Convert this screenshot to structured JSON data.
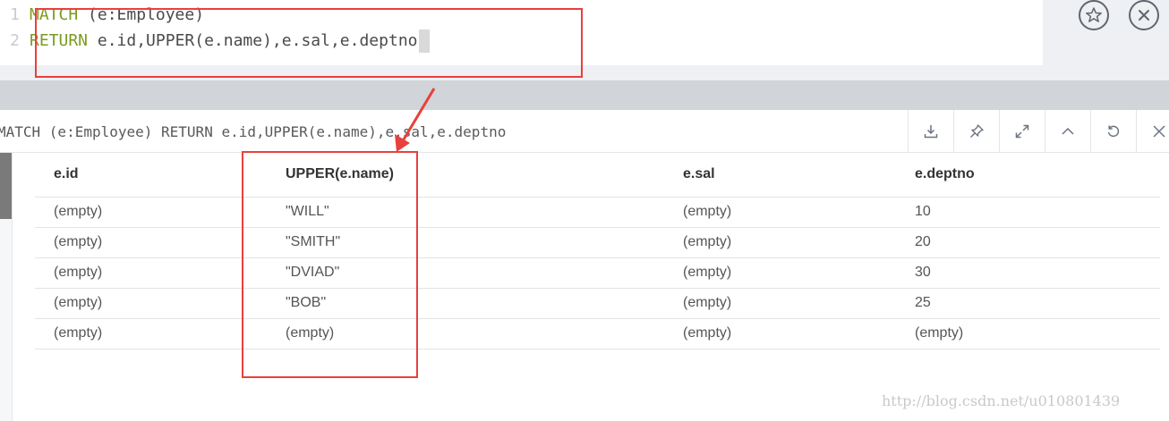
{
  "editor": {
    "line1": {
      "number": "1",
      "keyword": "MATCH",
      "text": " (e:Employee)"
    },
    "line2": {
      "number": "2",
      "keyword": "RETURN",
      "text": " e.id,UPPER(e.name),e.sal,e.deptno"
    },
    "actions": {
      "favorite_icon": "star-icon",
      "close_icon": "close-icon"
    }
  },
  "result_frame": {
    "query": "MATCH (e:Employee) RETURN e.id,UPPER(e.name),e.sal,e.deptno",
    "tools": [
      "download-icon",
      "pin-icon",
      "expand-icon",
      "collapse-icon",
      "rerun-icon",
      "close-icon"
    ],
    "table": {
      "columns": [
        "e.id",
        "UPPER(e.name)",
        "e.sal",
        "e.deptno"
      ],
      "rows": [
        [
          "(empty)",
          "\"WILL\"",
          "(empty)",
          "10"
        ],
        [
          "(empty)",
          "\"SMITH\"",
          "(empty)",
          "20"
        ],
        [
          "(empty)",
          "\"DVIAD\"",
          "(empty)",
          "30"
        ],
        [
          "(empty)",
          "\"BOB\"",
          "(empty)",
          "25"
        ],
        [
          "(empty)",
          "(empty)",
          "(empty)",
          "(empty)"
        ]
      ]
    }
  },
  "annotations": {
    "color": "#e8403c"
  },
  "watermark": "http://blog.csdn.net/u010801439"
}
